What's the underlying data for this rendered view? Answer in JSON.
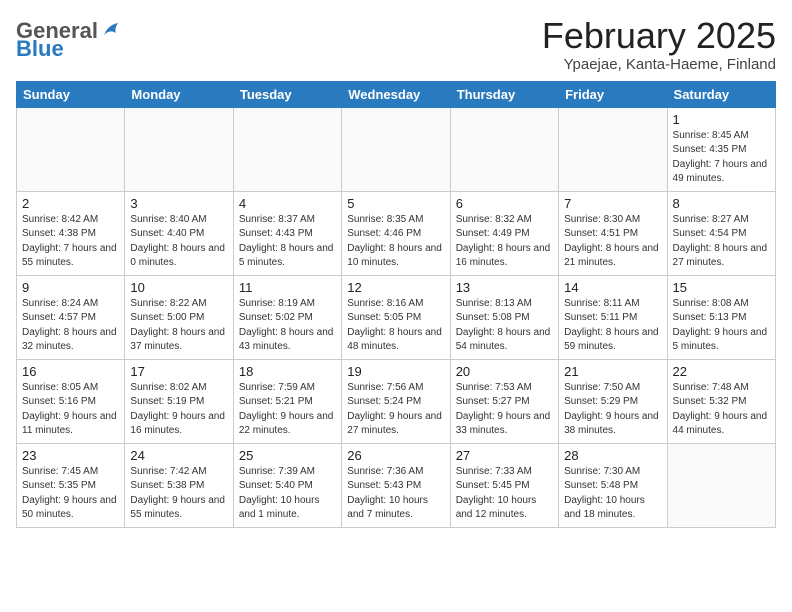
{
  "header": {
    "logo_general": "General",
    "logo_blue": "Blue",
    "month_title": "February 2025",
    "location": "Ypaejae, Kanta-Haeme, Finland"
  },
  "weekdays": [
    "Sunday",
    "Monday",
    "Tuesday",
    "Wednesday",
    "Thursday",
    "Friday",
    "Saturday"
  ],
  "weeks": [
    [
      {
        "day": "",
        "info": ""
      },
      {
        "day": "",
        "info": ""
      },
      {
        "day": "",
        "info": ""
      },
      {
        "day": "",
        "info": ""
      },
      {
        "day": "",
        "info": ""
      },
      {
        "day": "",
        "info": ""
      },
      {
        "day": "1",
        "info": "Sunrise: 8:45 AM\nSunset: 4:35 PM\nDaylight: 7 hours and 49 minutes."
      }
    ],
    [
      {
        "day": "2",
        "info": "Sunrise: 8:42 AM\nSunset: 4:38 PM\nDaylight: 7 hours and 55 minutes."
      },
      {
        "day": "3",
        "info": "Sunrise: 8:40 AM\nSunset: 4:40 PM\nDaylight: 8 hours and 0 minutes."
      },
      {
        "day": "4",
        "info": "Sunrise: 8:37 AM\nSunset: 4:43 PM\nDaylight: 8 hours and 5 minutes."
      },
      {
        "day": "5",
        "info": "Sunrise: 8:35 AM\nSunset: 4:46 PM\nDaylight: 8 hours and 10 minutes."
      },
      {
        "day": "6",
        "info": "Sunrise: 8:32 AM\nSunset: 4:49 PM\nDaylight: 8 hours and 16 minutes."
      },
      {
        "day": "7",
        "info": "Sunrise: 8:30 AM\nSunset: 4:51 PM\nDaylight: 8 hours and 21 minutes."
      },
      {
        "day": "8",
        "info": "Sunrise: 8:27 AM\nSunset: 4:54 PM\nDaylight: 8 hours and 27 minutes."
      }
    ],
    [
      {
        "day": "9",
        "info": "Sunrise: 8:24 AM\nSunset: 4:57 PM\nDaylight: 8 hours and 32 minutes."
      },
      {
        "day": "10",
        "info": "Sunrise: 8:22 AM\nSunset: 5:00 PM\nDaylight: 8 hours and 37 minutes."
      },
      {
        "day": "11",
        "info": "Sunrise: 8:19 AM\nSunset: 5:02 PM\nDaylight: 8 hours and 43 minutes."
      },
      {
        "day": "12",
        "info": "Sunrise: 8:16 AM\nSunset: 5:05 PM\nDaylight: 8 hours and 48 minutes."
      },
      {
        "day": "13",
        "info": "Sunrise: 8:13 AM\nSunset: 5:08 PM\nDaylight: 8 hours and 54 minutes."
      },
      {
        "day": "14",
        "info": "Sunrise: 8:11 AM\nSunset: 5:11 PM\nDaylight: 8 hours and 59 minutes."
      },
      {
        "day": "15",
        "info": "Sunrise: 8:08 AM\nSunset: 5:13 PM\nDaylight: 9 hours and 5 minutes."
      }
    ],
    [
      {
        "day": "16",
        "info": "Sunrise: 8:05 AM\nSunset: 5:16 PM\nDaylight: 9 hours and 11 minutes."
      },
      {
        "day": "17",
        "info": "Sunrise: 8:02 AM\nSunset: 5:19 PM\nDaylight: 9 hours and 16 minutes."
      },
      {
        "day": "18",
        "info": "Sunrise: 7:59 AM\nSunset: 5:21 PM\nDaylight: 9 hours and 22 minutes."
      },
      {
        "day": "19",
        "info": "Sunrise: 7:56 AM\nSunset: 5:24 PM\nDaylight: 9 hours and 27 minutes."
      },
      {
        "day": "20",
        "info": "Sunrise: 7:53 AM\nSunset: 5:27 PM\nDaylight: 9 hours and 33 minutes."
      },
      {
        "day": "21",
        "info": "Sunrise: 7:50 AM\nSunset: 5:29 PM\nDaylight: 9 hours and 38 minutes."
      },
      {
        "day": "22",
        "info": "Sunrise: 7:48 AM\nSunset: 5:32 PM\nDaylight: 9 hours and 44 minutes."
      }
    ],
    [
      {
        "day": "23",
        "info": "Sunrise: 7:45 AM\nSunset: 5:35 PM\nDaylight: 9 hours and 50 minutes."
      },
      {
        "day": "24",
        "info": "Sunrise: 7:42 AM\nSunset: 5:38 PM\nDaylight: 9 hours and 55 minutes."
      },
      {
        "day": "25",
        "info": "Sunrise: 7:39 AM\nSunset: 5:40 PM\nDaylight: 10 hours and 1 minute."
      },
      {
        "day": "26",
        "info": "Sunrise: 7:36 AM\nSunset: 5:43 PM\nDaylight: 10 hours and 7 minutes."
      },
      {
        "day": "27",
        "info": "Sunrise: 7:33 AM\nSunset: 5:45 PM\nDaylight: 10 hours and 12 minutes."
      },
      {
        "day": "28",
        "info": "Sunrise: 7:30 AM\nSunset: 5:48 PM\nDaylight: 10 hours and 18 minutes."
      },
      {
        "day": "",
        "info": ""
      }
    ]
  ]
}
